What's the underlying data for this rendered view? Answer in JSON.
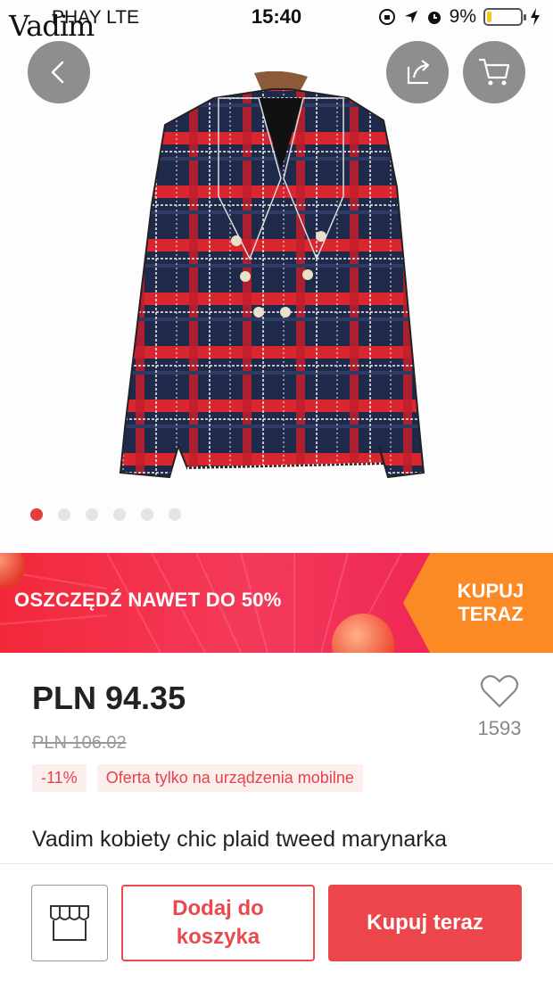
{
  "status_bar": {
    "carrier": "PHAY  LTE",
    "time": "15:40",
    "battery": "9%"
  },
  "hero": {
    "brand_logo": "Vadim",
    "image_count": 6,
    "active_image": 0
  },
  "banner": {
    "text": "OSZCZĘDŹ NAWET DO 50%",
    "cta": "KUPUJ TERAZ"
  },
  "product": {
    "price": "PLN 94.35",
    "old_price": "PLN 106.02",
    "discount_tag": "-11%",
    "mobile_tag": "Oferta tylko na urządzenia mobilne",
    "wishlist_count": "1593",
    "title": "Vadim kobiety chic plaid tweed marynarka"
  },
  "actions": {
    "add_to_cart": "Dodaj do koszyka",
    "buy_now": "Kupuj teraz"
  },
  "colors": {
    "accent": "#e84a4f",
    "banner_orange": "#fb8a24",
    "dot_active": "#e43d3d"
  },
  "icons": {
    "back": "chevron-left-icon",
    "share": "share-icon",
    "cart": "cart-icon",
    "wishlist": "heart-icon",
    "store": "store-icon"
  }
}
